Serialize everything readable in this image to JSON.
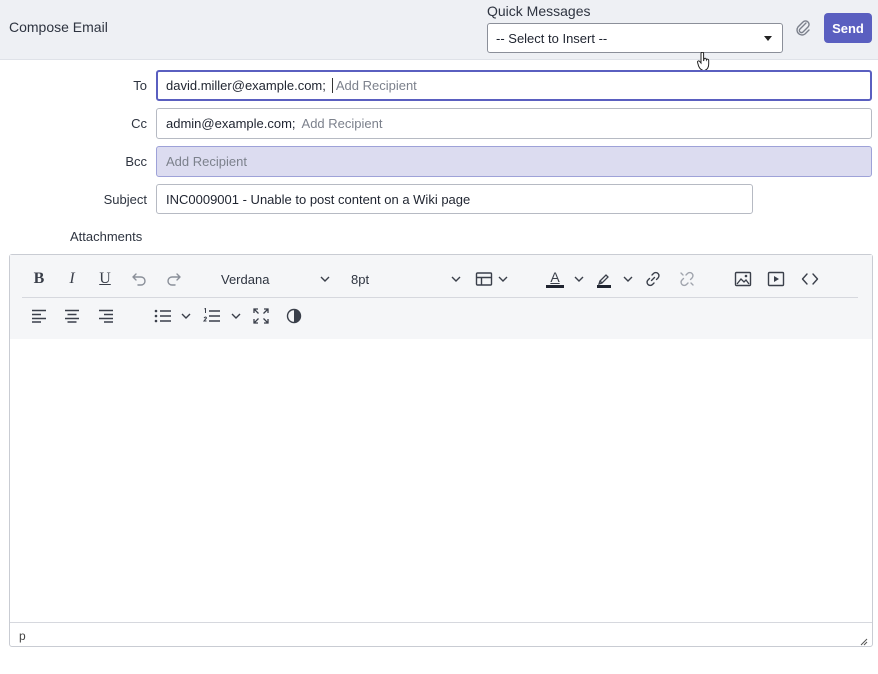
{
  "header": {
    "title": "Compose Email",
    "quick_messages_label": "Quick Messages",
    "quick_messages_value": "-- Select to Insert --",
    "send_label": "Send"
  },
  "fields": {
    "to": {
      "label": "To",
      "recipients": [
        "david.miller@example.com;"
      ],
      "placeholder": "Add Recipient"
    },
    "cc": {
      "label": "Cc",
      "recipients": [
        "admin@example.com;"
      ],
      "placeholder": "Add Recipient"
    },
    "bcc": {
      "label": "Bcc",
      "placeholder": "Add Recipient"
    },
    "subject": {
      "label": "Subject",
      "value": "INC0009001 - Unable to post content on a Wiki page"
    },
    "attachments_label": "Attachments"
  },
  "editor": {
    "font_family": "Verdana",
    "font_size": "8pt",
    "status_path": "p",
    "toolbar_icons": [
      "bold-icon",
      "italic-icon",
      "underline-icon",
      "undo-icon",
      "redo-icon",
      "table-icon",
      "text-color-icon",
      "highlight-color-icon",
      "link-icon",
      "unlink-icon",
      "image-icon",
      "media-icon",
      "code-icon",
      "align-left-icon",
      "align-center-icon",
      "align-right-icon",
      "bullet-list-icon",
      "numbered-list-icon",
      "fullscreen-icon",
      "contrast-icon"
    ],
    "bold_glyph": "B",
    "italic_glyph": "I",
    "underline_glyph": "U",
    "text_color_glyph": "A"
  },
  "colors": {
    "accent": "#5a5fc0",
    "bcc_background": "#dcdcf0"
  }
}
